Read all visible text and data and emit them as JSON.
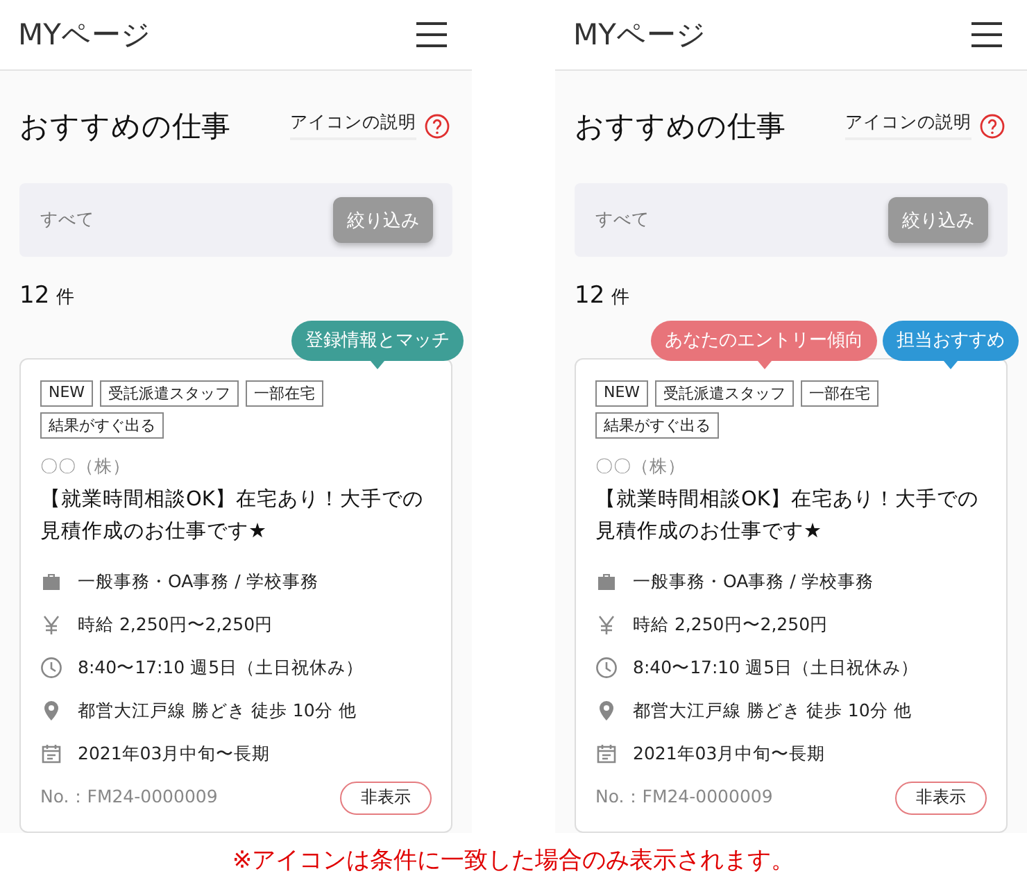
{
  "screens": [
    {
      "header": {
        "title": "MYページ"
      },
      "section_title": "おすすめの仕事",
      "help_link": "アイコンの説明",
      "filter": {
        "label": "すべて",
        "button": "絞り込み"
      },
      "count": "12",
      "count_unit": "件",
      "badges": [
        {
          "label": "登録情報とマッチ",
          "color": "#3e9e96"
        }
      ],
      "card": {
        "tags": [
          "NEW",
          "受託派遣スタッフ",
          "一部在宅",
          "結果がすぐ出る"
        ],
        "company": "〇〇（株）",
        "title": "【就業時間相談OK】在宅あり！大手での見積作成のお仕事です★",
        "details": [
          {
            "kind": "job",
            "text": "一般事務・OA事務 / 学校事務"
          },
          {
            "kind": "pay",
            "text": "時給 2,250円〜2,250円"
          },
          {
            "kind": "hours",
            "text": "8:40〜17:10 週5日（土日祝休み）"
          },
          {
            "kind": "station",
            "text": "都営大江戸線 勝どき 徒歩 10分 他"
          },
          {
            "kind": "period",
            "text": "2021年03月中旬〜長期"
          }
        ],
        "number": "No.：FM24-0000009",
        "hide_button": "非表示"
      }
    },
    {
      "header": {
        "title": "MYページ"
      },
      "section_title": "おすすめの仕事",
      "help_link": "アイコンの説明",
      "filter": {
        "label": "すべて",
        "button": "絞り込み"
      },
      "count": "12",
      "count_unit": "件",
      "badges": [
        {
          "label": "あなたのエントリー傾向",
          "color": "#e8747a"
        },
        {
          "label": "担当おすすめ",
          "color": "#2d97d6"
        }
      ],
      "card": {
        "tags": [
          "NEW",
          "受託派遣スタッフ",
          "一部在宅",
          "結果がすぐ出る"
        ],
        "company": "〇〇（株）",
        "title": "【就業時間相談OK】在宅あり！大手での見積作成のお仕事です★",
        "details": [
          {
            "kind": "job",
            "text": "一般事務・OA事務 / 学校事務"
          },
          {
            "kind": "pay",
            "text": "時給 2,250円〜2,250円"
          },
          {
            "kind": "hours",
            "text": "8:40〜17:10 週5日（土日祝休み）"
          },
          {
            "kind": "station",
            "text": "都営大江戸線 勝どき 徒歩 10分 他"
          },
          {
            "kind": "period",
            "text": "2021年03月中旬〜長期"
          }
        ],
        "number": "No.：FM24-0000009",
        "hide_button": "非表示"
      }
    }
  ],
  "footnote": "※アイコンは条件に一致した場合のみ表示されます。"
}
